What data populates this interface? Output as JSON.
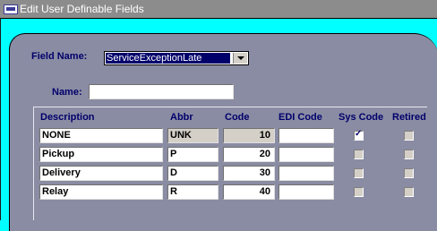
{
  "window": {
    "title": "Edit User Definable Fields"
  },
  "field_name": {
    "label": "Field Name:",
    "value": "ServiceExceptionLate"
  },
  "name": {
    "label": "Name:",
    "value": ""
  },
  "columns": {
    "description": "Description",
    "abbr": "Abbr",
    "code": "Code",
    "edi_code": "EDI Code",
    "sys_code": "Sys Code",
    "retired": "Retired"
  },
  "rows": [
    {
      "description": "NONE",
      "abbr": "UNK",
      "code": "10",
      "edi_code": "",
      "sys_code": true,
      "retired": false
    },
    {
      "description": "Pickup",
      "abbr": "P",
      "code": "20",
      "edi_code": "",
      "sys_code": false,
      "retired": false
    },
    {
      "description": "Delivery",
      "abbr": "D",
      "code": "30",
      "edi_code": "",
      "sys_code": false,
      "retired": false
    },
    {
      "description": "Relay",
      "abbr": "R",
      "code": "40",
      "edi_code": "",
      "sys_code": false,
      "retired": false
    }
  ]
}
